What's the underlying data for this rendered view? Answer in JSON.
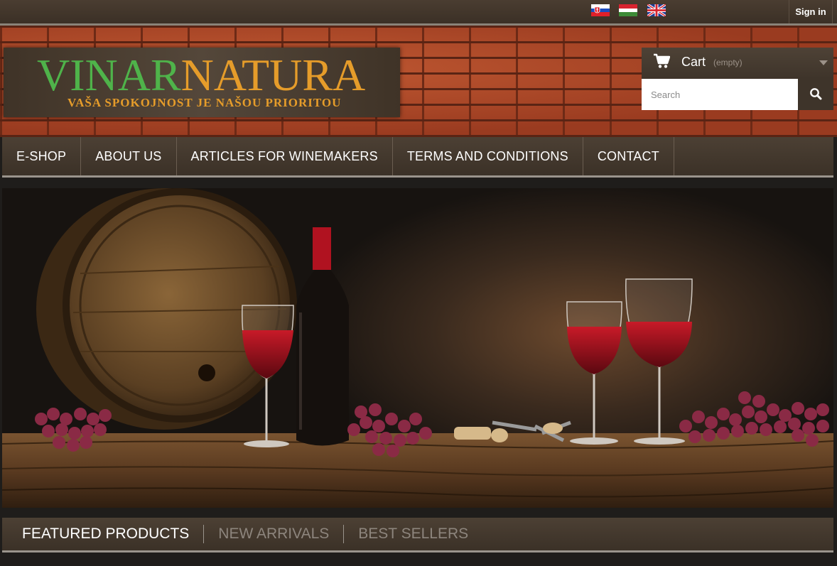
{
  "topbar": {
    "languages": [
      {
        "code": "sk",
        "icon": "slovakia-flag-icon"
      },
      {
        "code": "hu",
        "icon": "hungary-flag-icon"
      },
      {
        "code": "en",
        "icon": "uk-flag-icon"
      }
    ],
    "sign_in": "Sign in"
  },
  "logo": {
    "part1": "VINAR",
    "part2": "NATURA",
    "tagline": "Vaša spokojnost je našou prioritou",
    "colors": {
      "green": "#4fb34a",
      "orange": "#e59c2a"
    }
  },
  "cart": {
    "label": "Cart",
    "status": "(empty)",
    "icon": "cart-icon"
  },
  "search": {
    "placeholder": "Search",
    "value": "",
    "icon": "search-icon"
  },
  "nav": {
    "items": [
      {
        "label": "E-SHOP"
      },
      {
        "label": "ABOUT US"
      },
      {
        "label": "ARTICLES FOR WINEMAKERS"
      },
      {
        "label": "TERMS AND CONDITIONS"
      },
      {
        "label": "CONTACT"
      }
    ]
  },
  "tabs": {
    "items": [
      {
        "label": "FEATURED PRODUCTS",
        "active": true
      },
      {
        "label": "NEW ARRIVALS",
        "active": false
      },
      {
        "label": "BEST SELLERS",
        "active": false
      }
    ]
  }
}
